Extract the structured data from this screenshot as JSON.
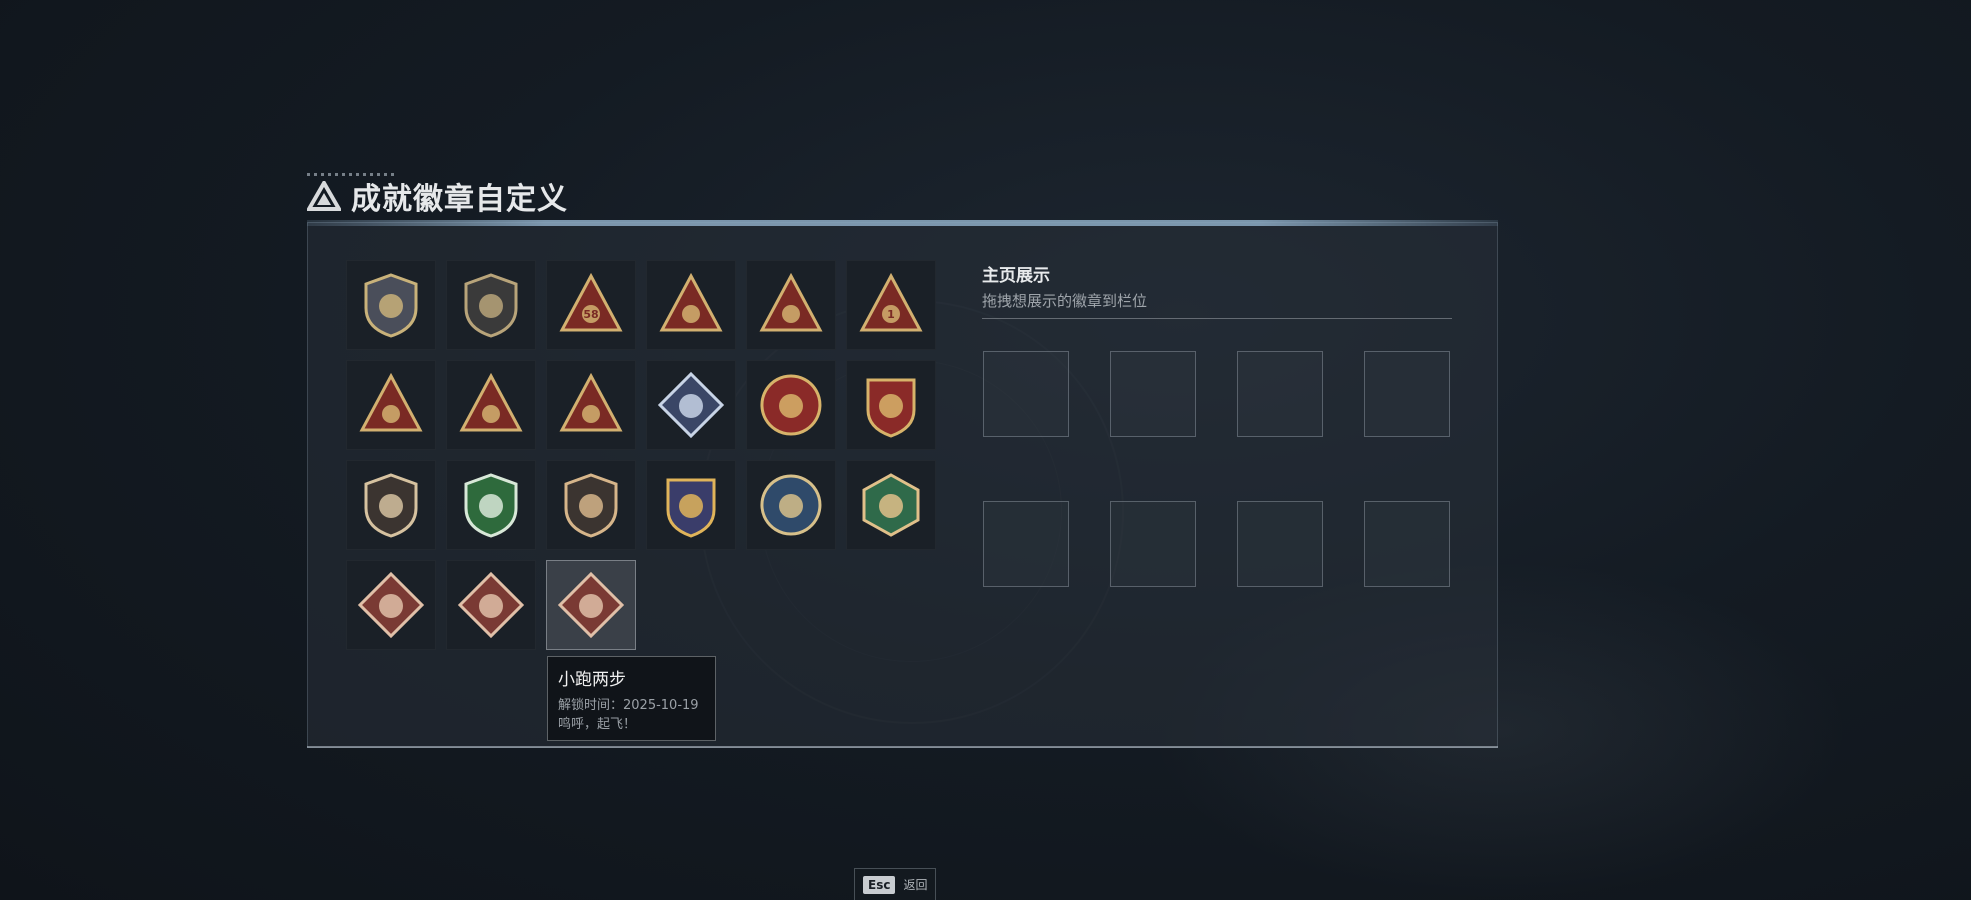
{
  "page": {
    "title": "成就徽章自定义"
  },
  "badges": [
    {
      "name": "badge-1-icon",
      "kind": "shield",
      "fill": "#4a4e5a",
      "accent": "#c9b27a"
    },
    {
      "name": "badge-2-icon",
      "kind": "shield",
      "fill": "#3a3a3a",
      "accent": "#b8a47a"
    },
    {
      "name": "badge-3-icon",
      "kind": "triangle",
      "fill": "#7a2a24",
      "accent": "#d2b070",
      "glyph": "58"
    },
    {
      "name": "badge-4-icon",
      "kind": "triangle",
      "fill": "#7a2a24",
      "accent": "#d2b070"
    },
    {
      "name": "badge-5-icon",
      "kind": "triangle",
      "fill": "#7a2a24",
      "accent": "#d2b070"
    },
    {
      "name": "badge-6-icon",
      "kind": "triangle",
      "fill": "#7a2a24",
      "accent": "#d2b070",
      "glyph": "1"
    },
    {
      "name": "badge-7-icon",
      "kind": "triangle",
      "fill": "#7a2a24",
      "accent": "#d2b070"
    },
    {
      "name": "badge-8-icon",
      "kind": "triangle",
      "fill": "#7a2a24",
      "accent": "#d2b070"
    },
    {
      "name": "badge-9-icon",
      "kind": "triangle",
      "fill": "#7a2a24",
      "accent": "#d2b070"
    },
    {
      "name": "badge-10-icon",
      "kind": "diamond",
      "fill": "#3a4666",
      "accent": "#c8d4e6"
    },
    {
      "name": "badge-11-icon",
      "kind": "circle",
      "fill": "#8a2a28",
      "accent": "#d7b36a"
    },
    {
      "name": "badge-12-icon",
      "kind": "crest",
      "fill": "#8a2a28",
      "accent": "#d7b36a"
    },
    {
      "name": "badge-13-icon",
      "kind": "shield",
      "fill": "#3b3430",
      "accent": "#d6c2a0"
    },
    {
      "name": "badge-14-icon",
      "kind": "shield",
      "fill": "#2e6a3c",
      "accent": "#d8e8d8"
    },
    {
      "name": "badge-15-icon",
      "kind": "shield",
      "fill": "#3b3430",
      "accent": "#d6b58a"
    },
    {
      "name": "badge-16-icon",
      "kind": "crest",
      "fill": "#3a3d6a",
      "accent": "#e0b45a"
    },
    {
      "name": "badge-17-icon",
      "kind": "circle",
      "fill": "#2f4a6a",
      "accent": "#d7c08a"
    },
    {
      "name": "badge-18-icon",
      "kind": "hexagon",
      "fill": "#2f6a4a",
      "accent": "#e0c08a"
    },
    {
      "name": "badge-19-icon",
      "kind": "diamond",
      "fill": "#7a3a34",
      "accent": "#e0c0a8"
    },
    {
      "name": "badge-20-icon",
      "kind": "diamond",
      "fill": "#7a3a34",
      "accent": "#e0c0a8"
    },
    {
      "name": "badge-21-icon",
      "kind": "diamond",
      "fill": "#7a3a34",
      "accent": "#e0c0a8"
    }
  ],
  "selected_badge_index": 20,
  "tooltip": {
    "title": "小跑两步",
    "unlock": "解锁时间：2025-10-19",
    "desc": "鸣呼，起飞！"
  },
  "showcase": {
    "title": "主页展示",
    "subtitle": "拖拽想展示的徽章到栏位",
    "slots": 8
  },
  "footer": {
    "key": "Esc",
    "label": "返回"
  }
}
